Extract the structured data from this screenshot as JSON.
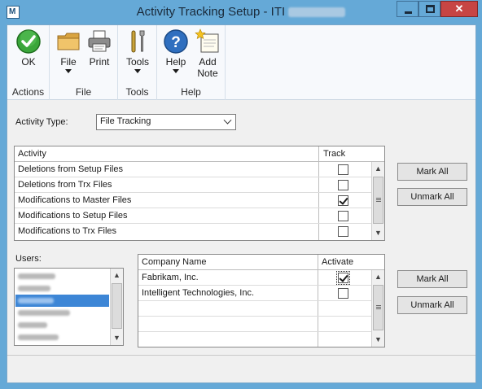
{
  "window": {
    "title": "Activity Tracking Setup  -  ITI",
    "app_icon_letter": "M",
    "close_glyph": "✕"
  },
  "ribbon": {
    "groups": [
      {
        "label": "Actions",
        "buttons": [
          {
            "label": "OK",
            "icon": "ok-check-icon"
          }
        ]
      },
      {
        "label": "File",
        "buttons": [
          {
            "label": "File",
            "icon": "folder-icon"
          },
          {
            "label": "Print",
            "icon": "printer-icon"
          }
        ]
      },
      {
        "label": "Tools",
        "buttons": [
          {
            "label": "Tools",
            "icon": "tools-icon"
          }
        ]
      },
      {
        "label": "Help",
        "buttons": [
          {
            "label": "Help",
            "icon": "help-icon"
          },
          {
            "label": "Add\nNote",
            "icon": "add-note-icon"
          }
        ]
      }
    ]
  },
  "form": {
    "activity_type_label": "Activity Type:",
    "activity_type_value": "File Tracking",
    "activity_grid": {
      "headers": [
        "Activity",
        "Track"
      ],
      "rows": [
        {
          "activity": "Deletions from Setup Files",
          "track": false
        },
        {
          "activity": "Deletions from Trx Files",
          "track": false
        },
        {
          "activity": "Modifications to Master Files",
          "track": true
        },
        {
          "activity": "Modifications to Setup Files",
          "track": false
        },
        {
          "activity": "Modifications to Trx Files",
          "track": false
        }
      ]
    },
    "activity_mark_all": "Mark All",
    "activity_unmark_all": "Unmark All",
    "users_label": "Users:",
    "company_grid": {
      "headers": [
        "Company Name",
        "Activate"
      ],
      "rows": [
        {
          "company": "Fabrikam, Inc.",
          "activate": true
        },
        {
          "company": "Intelligent Technologies, Inc.",
          "activate": false
        },
        {
          "company": "",
          "activate": null
        },
        {
          "company": "",
          "activate": null
        },
        {
          "company": "",
          "activate": null
        }
      ]
    },
    "company_mark_all": "Mark All",
    "company_unmark_all": "Unmark All"
  },
  "colors": {
    "title_bar": "#65a9d7",
    "close_button": "#c74544",
    "selection": "#3d86d6",
    "ok_green": "#3aa63a",
    "help_blue": "#2f6fbf"
  }
}
